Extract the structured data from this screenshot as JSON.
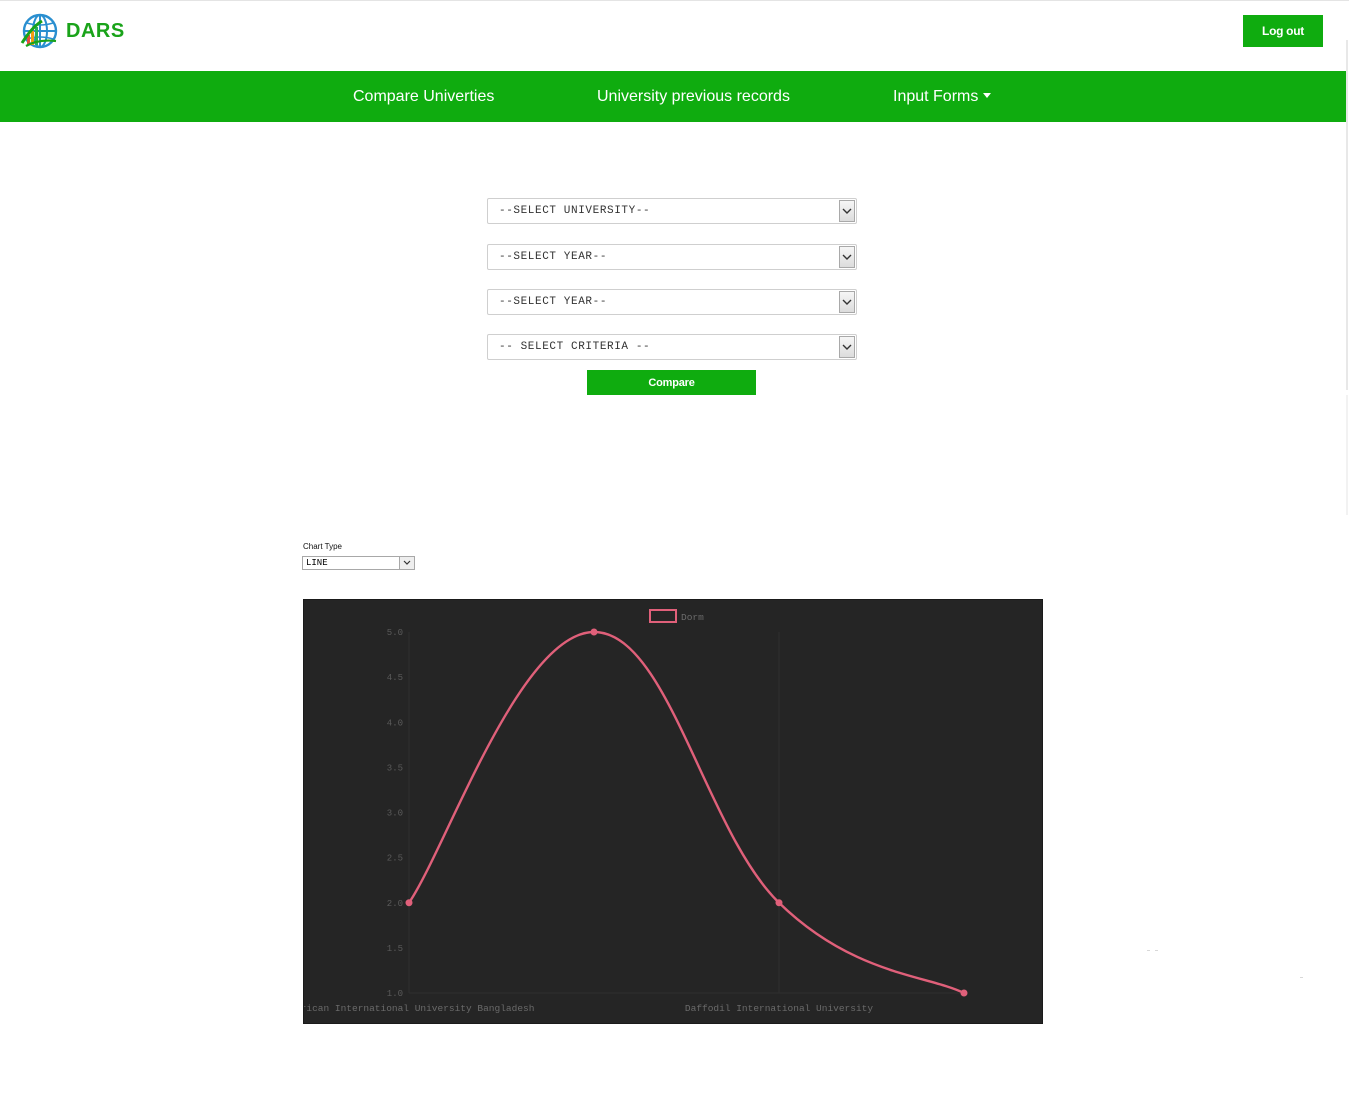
{
  "app": {
    "logo_text": "DARS",
    "logout_label": "Log out"
  },
  "nav": {
    "compare": "Compare Univerties",
    "records": "University previous records",
    "forms": "Input Forms"
  },
  "form": {
    "university": "--SELECT UNIVERSITY--",
    "year1": "--SELECT YEAR--",
    "year2": "--SELECT YEAR--",
    "criteria": "-- SELECT CRITERIA --",
    "compare_label": "Compare"
  },
  "chart_type": {
    "label": "Chart Type",
    "value": "LINE"
  },
  "colors": {
    "brand_green": "#0fac0f",
    "series_line": "#e0607a",
    "chart_bg": "#252525"
  },
  "chart_data": {
    "type": "line",
    "categories": [
      "American International University Bangladesh",
      "",
      "Daffodil International University",
      ""
    ],
    "series": [
      {
        "name": "Dorm",
        "values": [
          2,
          5,
          2,
          1
        ]
      }
    ],
    "ylim": [
      1,
      5
    ],
    "yticks": [
      "5.0",
      "4.5",
      "4.0",
      "3.5",
      "3.0",
      "2.5",
      "2.0",
      "1.5",
      "1.0"
    ],
    "legend": "top-center",
    "grid": false,
    "xlabel": "",
    "ylabel": ""
  }
}
